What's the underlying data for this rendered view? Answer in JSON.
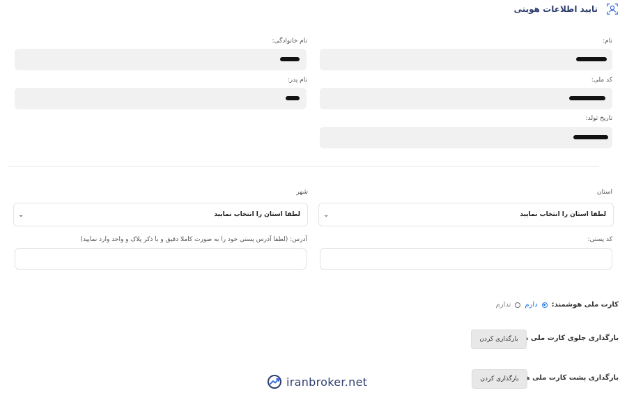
{
  "header": {
    "title": "تایید اطلاعات هویتی",
    "icon": "user-verify-icon"
  },
  "identity": {
    "first_name_label": "نام:",
    "last_name_label": "نام خانوادگی:",
    "national_code_label": "کد ملی:",
    "father_name_label": "نام پدر:",
    "birth_date_label": "تاریخ تولد:"
  },
  "address": {
    "province_label": "استان",
    "province_value": "لطفا استان را انتخاب نمایید",
    "city_label": "شهر",
    "city_value": "لطفا استان را انتخاب نمایید",
    "postal_code_label": "کد پستی:",
    "address_label": "آدرس: (لطفا آدرس پستی خود را به صورت کاملا دقیق و با ذکر پلاک و واحد وارد نمایید)"
  },
  "smart_card": {
    "question": "کارت ملی هوشمند:",
    "option_yes": "دارم",
    "option_no": "ندارم",
    "selected": "دارم"
  },
  "uploads": {
    "front_label": "بارگذاری جلوی کارت ملی هوشمند:",
    "front_button": "بارگذاری کردن",
    "back_label": "بارگذاری پشت کارت ملی هوشمند:",
    "back_button": "بارگذاری کردن"
  },
  "watermark": {
    "text": "iranbroker.net"
  },
  "colors": {
    "accent": "#1a73e8",
    "title": "#2f3e6f",
    "field_bg": "#f1f1f1"
  }
}
